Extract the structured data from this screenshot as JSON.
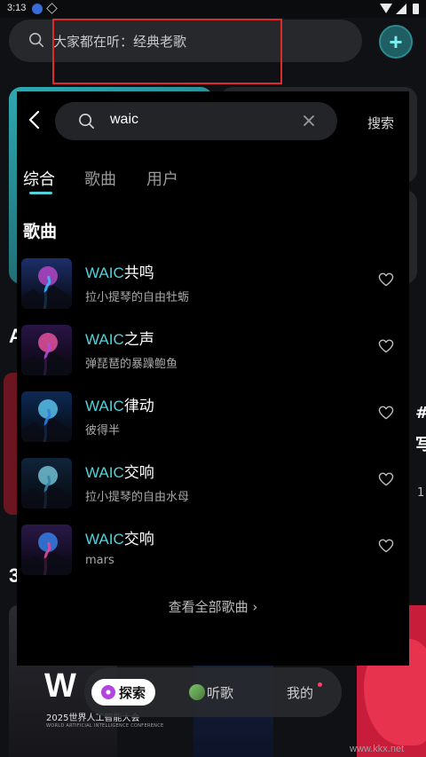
{
  "status_bar": {
    "time": "3:13"
  },
  "background": {
    "search_placeholder": "大家都在听：经典老歌",
    "add_label": "+",
    "letter_a": "A",
    "letter_3": "3",
    "right_card_text": "#\n写",
    "right_card_num": "1",
    "banner_w": "W",
    "banner_year": "2025世界人工智能大会",
    "banner_sub": "WORLD ARTIFICIAL INTELLIGENCE CONFERENCE",
    "watermark": "www.kkx.net"
  },
  "search": {
    "query": "waic",
    "submit_label": "搜索"
  },
  "tabs": [
    {
      "label": "综合",
      "active": true
    },
    {
      "label": "歌曲",
      "active": false
    },
    {
      "label": "用户",
      "active": false
    }
  ],
  "section": {
    "title": "歌曲"
  },
  "songs": [
    {
      "highlight": "WAIC",
      "title_rest": "共鸣",
      "artist": "拉小提琴的自由牡蛎",
      "cover": [
        "#1d2f6a",
        "#3fb7ff",
        "#c94bd6"
      ]
    },
    {
      "highlight": "WAIC",
      "title_rest": "之声",
      "artist": "弹琵琶的暴躁鲍鱼",
      "cover": [
        "#2a1446",
        "#b04ad8",
        "#ff5aa8"
      ]
    },
    {
      "highlight": "WAIC",
      "title_rest": "律动",
      "artist": "彼得半",
      "cover": [
        "#0d2a55",
        "#2f7fe0",
        "#63d6ff"
      ]
    },
    {
      "highlight": "WAIC",
      "title_rest": "交响",
      "artist": "拉小提琴的自由水母",
      "cover": [
        "#10243a",
        "#3a7fa8",
        "#7ed6e8"
      ]
    },
    {
      "highlight": "WAIC",
      "title_rest": "交响",
      "artist": "mars",
      "cover": [
        "#2a1848",
        "#e04a9a",
        "#3a8cff"
      ]
    }
  ],
  "view_all_label": "查看全部歌曲 ›",
  "bottom_nav": {
    "explore_label": "探索",
    "listen_label": "听歌",
    "mine_label": "我的"
  },
  "colors": {
    "accent": "#4fd3dc",
    "highlight_box": "#e02a2a"
  },
  "icons": [
    "back-icon",
    "search-icon",
    "clear-icon",
    "heart-icon",
    "add-icon"
  ]
}
